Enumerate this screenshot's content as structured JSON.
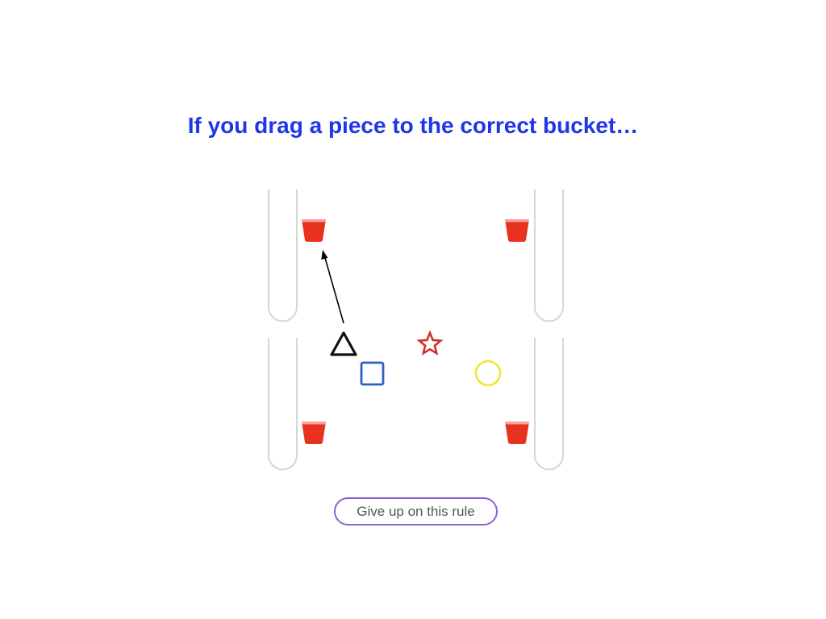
{
  "prompt": {
    "text": "If you drag a piece to the correct bucket…",
    "color": "#1f35e8"
  },
  "buckets": [
    {
      "name": "top-left",
      "icon": "bucket-icon",
      "color": "#e8321f"
    },
    {
      "name": "top-right",
      "icon": "bucket-icon",
      "color": "#e8321f"
    },
    {
      "name": "bottom-left",
      "icon": "bucket-icon",
      "color": "#e8321f"
    },
    {
      "name": "bottom-right",
      "icon": "bucket-icon",
      "color": "#e8321f"
    }
  ],
  "pieces": [
    {
      "shape": "triangle",
      "icon": "triangle-icon",
      "color": "#111111"
    },
    {
      "shape": "star",
      "icon": "star-icon",
      "color": "#d0302a"
    },
    {
      "shape": "square",
      "icon": "square-icon",
      "color": "#2e5fc6"
    },
    {
      "shape": "circle",
      "icon": "circle-icon",
      "color": "#f2e43a"
    }
  ],
  "hint_arrow": {
    "from": "triangle",
    "to": "top-left bucket",
    "icon": "arrow-icon"
  },
  "give_up_button": {
    "label": "Give up on this rule",
    "border_color": "#8a63d2"
  }
}
